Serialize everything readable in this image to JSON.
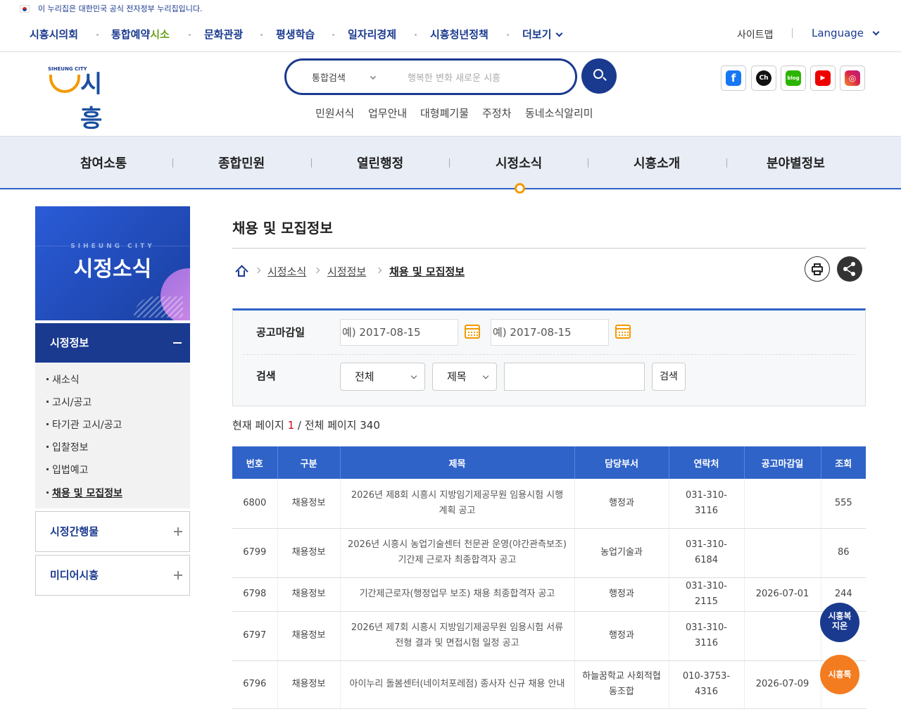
{
  "gov_banner": "이 누리집은 대한민국 공식 전자정부 누리집입니다.",
  "util_nav": {
    "items": [
      "시흥시의회",
      "통합예약",
      "시소",
      "문화관광",
      "평생학습",
      "일자리경제",
      "시흥청년정책",
      "더보기"
    ],
    "sitemap": "사이트맵",
    "language": "Language"
  },
  "logo": {
    "small": "SIHEUNG CITY",
    "big": "시흥"
  },
  "search": {
    "select": "통합검색",
    "placeholder": "행복한 변화 새로운 시흥"
  },
  "quick_links": [
    "민원서식",
    "업무안내",
    "대형폐기물",
    "주정차",
    "동네소식알리미"
  ],
  "sns": [
    "facebook-icon",
    "kakao-channel-icon",
    "blog-icon",
    "youtube-icon",
    "instagram-icon"
  ],
  "gnb": [
    "참여소통",
    "종합민원",
    "열린행정",
    "시정소식",
    "시흥소개",
    "분야별정보"
  ],
  "lnb": {
    "en": "SIHEUNG CITY",
    "title": "시정소식",
    "section": "시정정보",
    "items": [
      "새소식",
      "고시/공고",
      "타기관 고시/공고",
      "입찰정보",
      "입법예고",
      "채용 및 모집정보"
    ],
    "other_sections": [
      "시정간행물",
      "미디어시흥"
    ]
  },
  "page": {
    "title": "채용 및 모집정보",
    "breadcrumb": [
      "시정소식",
      "시정정보",
      "채용 및 모집정보"
    ]
  },
  "filter": {
    "date_label": "공고마감일",
    "date_from": "예) 2017-08-15",
    "date_to": "예) 2017-08-15",
    "search_label": "검색",
    "category": "전체",
    "field": "제목",
    "button": "검색"
  },
  "pageinfo": {
    "prefix": "현재 페이지",
    "current": "1",
    "mid": "/ 전체 페이지",
    "total": "340"
  },
  "table": {
    "headers": [
      "번호",
      "구분",
      "제목",
      "담당부서",
      "연락처",
      "공고마감일",
      "조회"
    ],
    "rows": [
      [
        "6800",
        "채용정보",
        "2026년 제8회 시흥시 지방임기제공무원 임용시험 시행계획 공고",
        "행정과",
        "031-310-3116",
        "",
        "555"
      ],
      [
        "6799",
        "채용정보",
        "2026년 시흥시 농업기술센터 천문관 운영(야간관측보조) 기간제 근로자 최종합격자 공고",
        "농업기술과",
        "031-310-6184",
        "",
        "86"
      ],
      [
        "6798",
        "채용정보",
        "기간제근로자(행정업무 보조) 채용 최종합격자 공고",
        "행정과",
        "031-310-2115",
        "2026-07-01",
        "244"
      ],
      [
        "6797",
        "채용정보",
        "2026년 제7회 시흥시 지방임기제공무원 임용시험 서류전형 결과 및 면접시험 일정 공고",
        "행정과",
        "031-310-3116",
        "",
        ""
      ],
      [
        "6796",
        "채용정보",
        "아이누리 돌봄센터(네이처포레점) 종사자 신규 채용 안내",
        "하늘꿈학교 사회적협동조합",
        "010-3753-4316",
        "2026-07-09",
        ""
      ]
    ]
  },
  "floating": {
    "welfare": "시흥복지온",
    "talk": "시흥톡"
  }
}
